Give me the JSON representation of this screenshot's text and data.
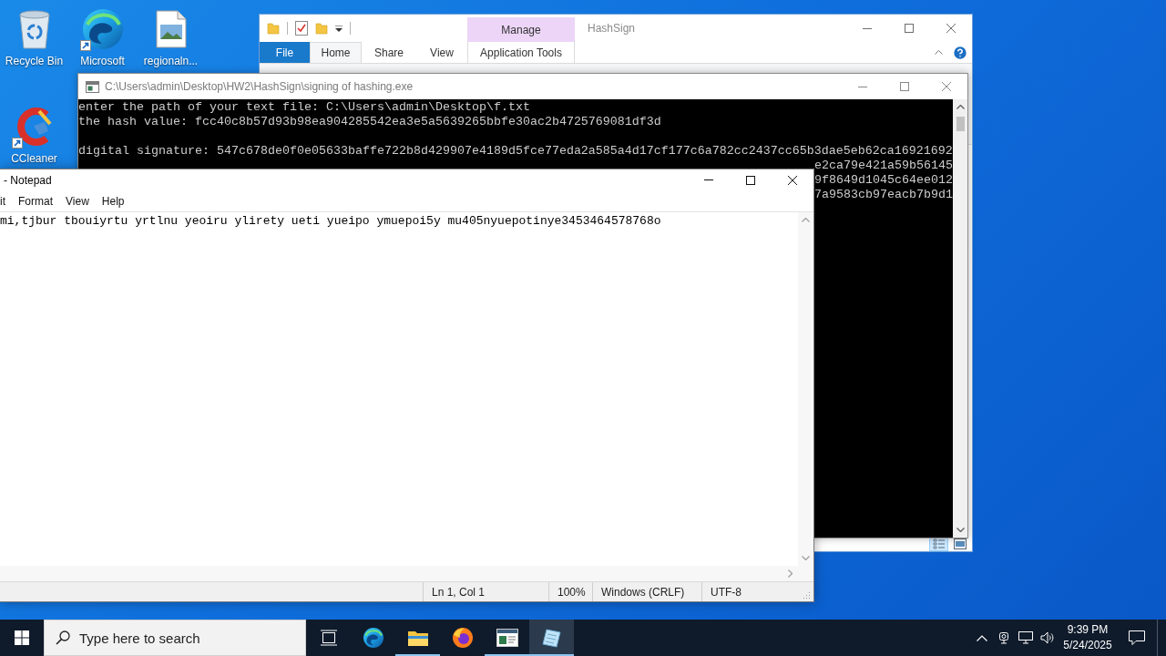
{
  "desktop_icons": [
    {
      "label": "Recycle Bin",
      "kind": "bin",
      "shortcut": false
    },
    {
      "label": "Microsoft",
      "kind": "browser",
      "shortcut": true
    },
    {
      "label": "regionaln...",
      "kind": "image",
      "shortcut": false
    },
    {
      "label": "CCleaner",
      "kind": "cleaner",
      "shortcut": true
    }
  ],
  "explorer": {
    "title": "HashSign",
    "context_header": "Manage",
    "tabs": [
      {
        "label": "File",
        "kind": "file",
        "selected": false
      },
      {
        "label": "Home",
        "kind": "tab",
        "selected": true
      },
      {
        "label": "Share",
        "kind": "tab",
        "selected": false
      },
      {
        "label": "View",
        "kind": "tab",
        "selected": false
      },
      {
        "label": "Application Tools",
        "kind": "context",
        "selected": false
      }
    ],
    "view_buttons": [
      {
        "kind": "details",
        "selected": true
      },
      {
        "kind": "thumbnails",
        "selected": false
      }
    ]
  },
  "console": {
    "title": "C:\\Users\\admin\\Desktop\\HW2\\HashSign\\signing of hashing.exe",
    "output_lines": [
      "enter the path of your text file: C:\\Users\\admin\\Desktop\\f.txt",
      "the hash value: fcc40c8b57d93b98ea904285542ea3e5a5639265bbfe30ac2b4725769081df3d"
    ],
    "signature_lines": [
      "digital signature: 547c678de0f0e05633baffe722b8d429907e4189d5fce77eda2a585a4d17cf177c6a782cc2437cc65b3dae5eb62ca16921692",
      "e2ca79e421a59b56145",
      "9f8649d1045c64ee012",
      "7a9583cb97eacb7b9d1"
    ]
  },
  "notepad": {
    "title": "- Notepad",
    "menu": [
      "it",
      "Format",
      "View",
      "Help"
    ],
    "text": "mi,tjbur tbouiyrtu yrtlnu yeoiru ylirety ueti yueipo ymuepoi5y mu405nyuepotinye3453464578768o",
    "status": [
      "Ln 1, Col 1",
      "100%",
      "Windows (CRLF)",
      "UTF-8"
    ]
  },
  "taskbar": {
    "search_placeholder": "Type here to search",
    "apps": [
      {
        "kind": "taskview",
        "running": false,
        "active": false
      },
      {
        "kind": "swirl",
        "running": false,
        "active": false
      },
      {
        "kind": "folder",
        "running": true,
        "active": false
      },
      {
        "kind": "globe",
        "running": false,
        "active": false
      },
      {
        "kind": "terminal",
        "running": true,
        "active": false
      },
      {
        "kind": "notepad",
        "running": true,
        "active": true
      }
    ],
    "time": "9:39 PM",
    "date": "5/24/2025"
  }
}
